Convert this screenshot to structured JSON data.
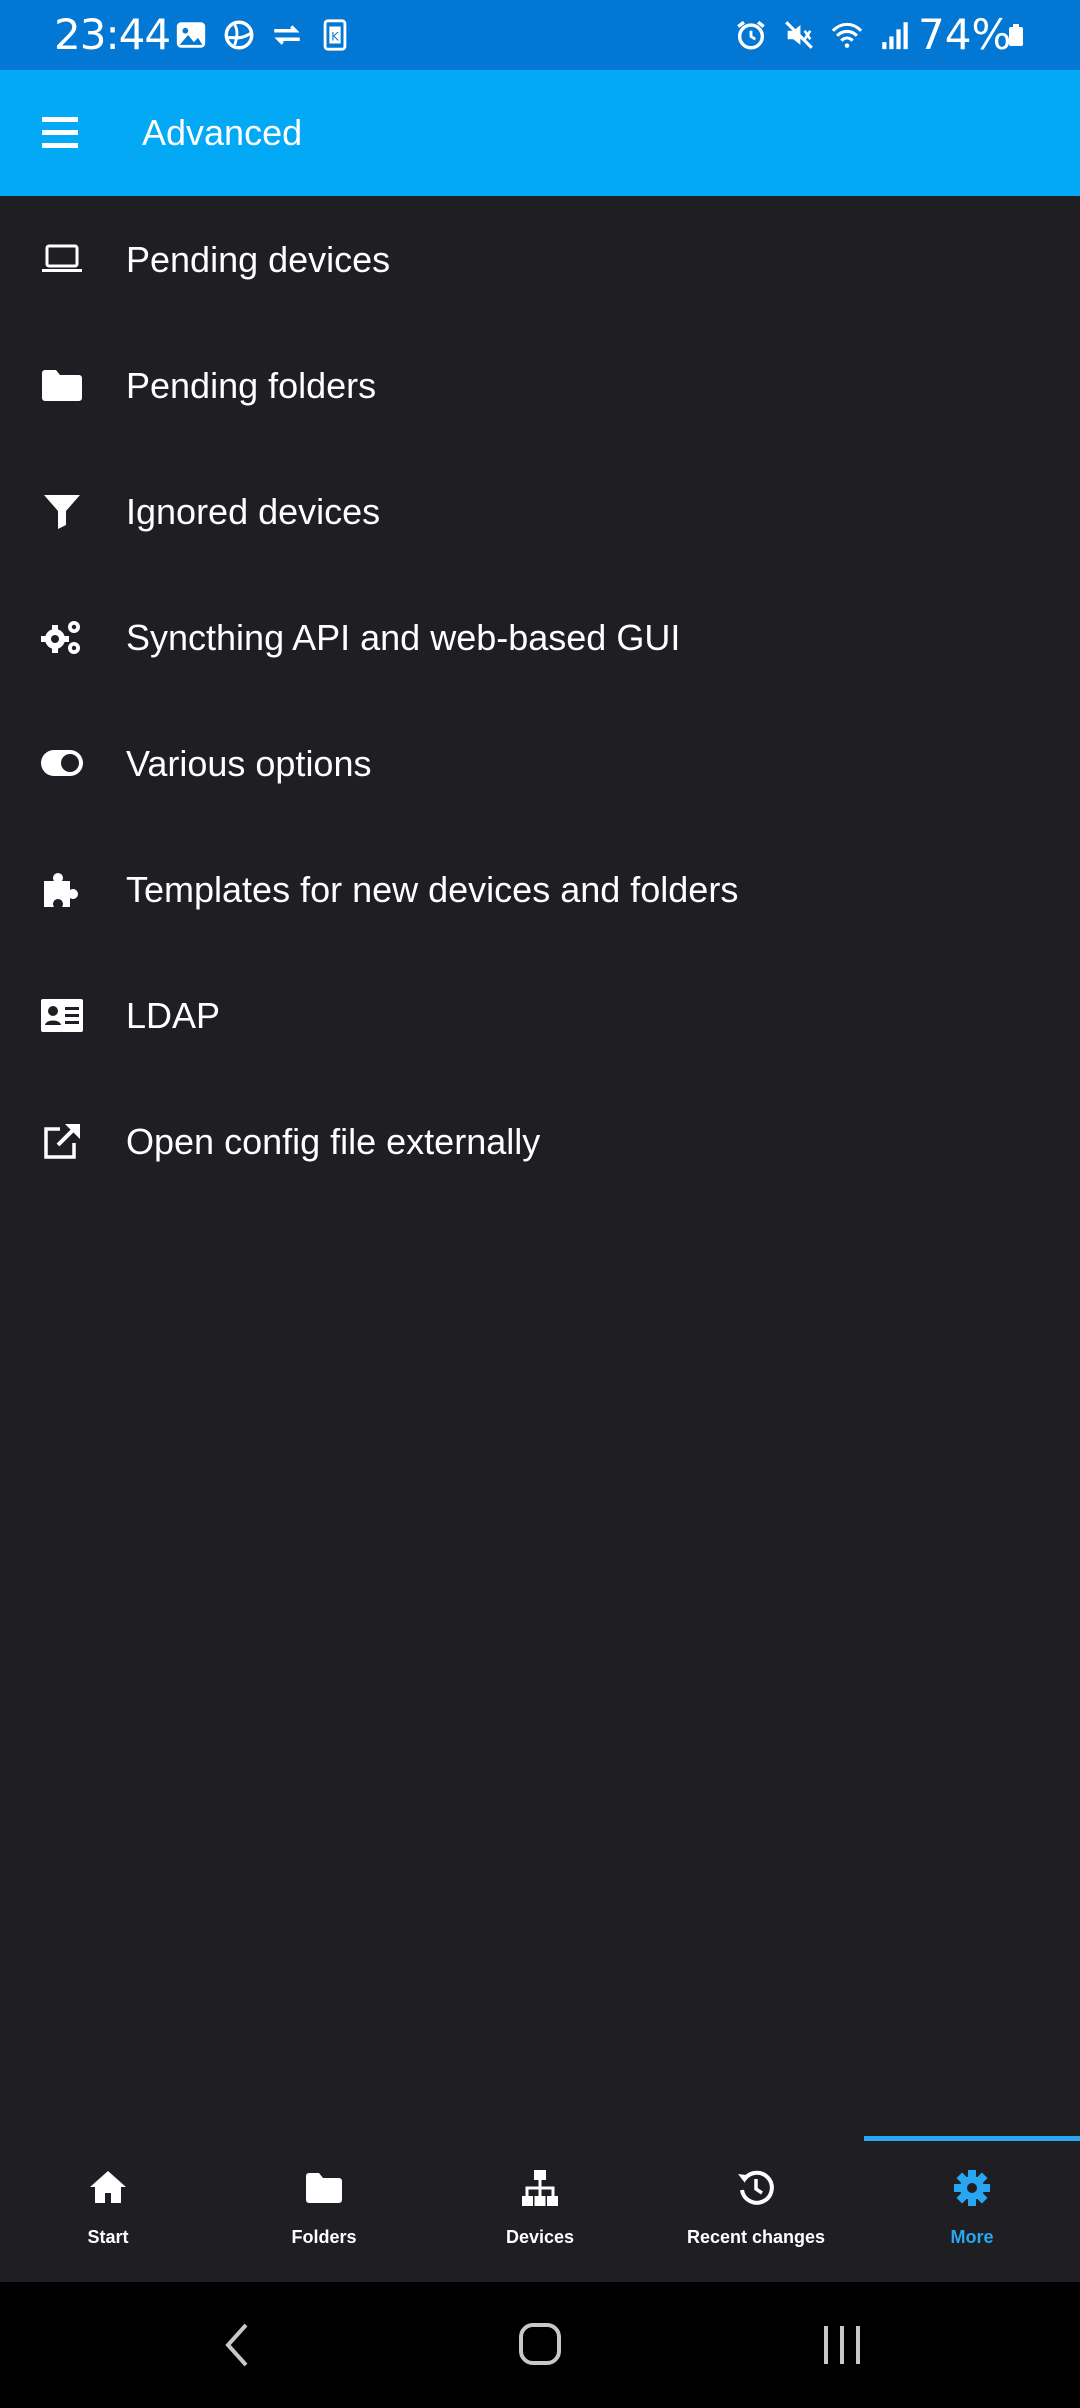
{
  "status_bar": {
    "time": "23:44",
    "battery": "74%",
    "left_icons": [
      "image-icon",
      "vpn-icon",
      "sync-arrows-icon",
      "sim-icon"
    ],
    "right_icons": [
      "alarm-icon",
      "mute-icon",
      "wifi-icon",
      "signal-icon",
      "battery-icon"
    ]
  },
  "app_bar": {
    "title": "Advanced",
    "menu_icon": "hamburger-menu-icon"
  },
  "menu_items": [
    {
      "label": "Pending devices",
      "icon": "laptop-icon"
    },
    {
      "label": "Pending folders",
      "icon": "folder-icon"
    },
    {
      "label": "Ignored devices",
      "icon": "filter-icon"
    },
    {
      "label": "Syncthing API and web-based GUI",
      "icon": "gears-icon"
    },
    {
      "label": "Various options",
      "icon": "toggle-icon"
    },
    {
      "label": "Templates for new devices and folders",
      "icon": "puzzle-icon"
    },
    {
      "label": "LDAP",
      "icon": "id-card-icon"
    },
    {
      "label": "Open config file externally",
      "icon": "external-link-icon"
    }
  ],
  "bottom_nav": {
    "active": "More",
    "active_color": "#29a6f0",
    "tabs": [
      {
        "label": "Start",
        "icon": "home-icon"
      },
      {
        "label": "Folders",
        "icon": "folder-icon"
      },
      {
        "label": "Devices",
        "icon": "network-icon"
      },
      {
        "label": "Recent changes",
        "icon": "history-icon"
      },
      {
        "label": "More",
        "icon": "gear-icon"
      }
    ]
  },
  "system_nav": {
    "buttons": [
      "back-icon",
      "home-circle-icon",
      "recents-icon"
    ]
  },
  "colors": {
    "status_bar": "#0277d4",
    "app_bar": "#03a9f4",
    "background": "#1f1e23",
    "accent": "#29a6f0"
  }
}
